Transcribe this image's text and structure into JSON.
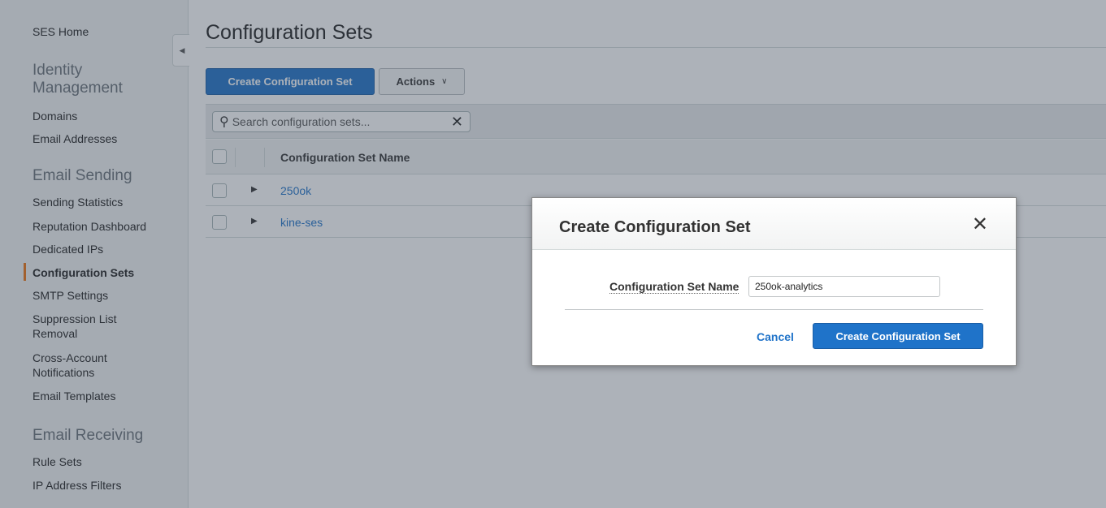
{
  "sidebar": {
    "home": "SES Home",
    "sections": [
      {
        "title": "Identity Management",
        "items": [
          "Domains",
          "Email Addresses"
        ]
      },
      {
        "title": "Email Sending",
        "items": [
          "Sending Statistics",
          "Reputation Dashboard",
          "Dedicated IPs",
          "Configuration Sets",
          "SMTP Settings",
          "Suppression List Removal",
          "Cross-Account Notifications",
          "Email Templates"
        ]
      },
      {
        "title": "Email Receiving",
        "items": [
          "Rule Sets",
          "IP Address Filters"
        ]
      }
    ],
    "active_item": "Configuration Sets",
    "collapse_icon": "chevron-left-icon"
  },
  "main": {
    "title": "Configuration Sets",
    "create_button": "Create Configuration Set",
    "actions_button": "Actions",
    "search_placeholder": "Search configuration sets...",
    "table": {
      "column": "Configuration Set Name",
      "rows": [
        "250ok",
        "kine-ses"
      ]
    }
  },
  "modal": {
    "title": "Create Configuration Set",
    "field_label": "Configuration Set Name",
    "field_value": "250ok-analytics",
    "cancel_label": "Cancel",
    "submit_label": "Create Configuration Set"
  },
  "colors": {
    "primary": "#1f73c9",
    "active_indicator": "#ec7211"
  }
}
